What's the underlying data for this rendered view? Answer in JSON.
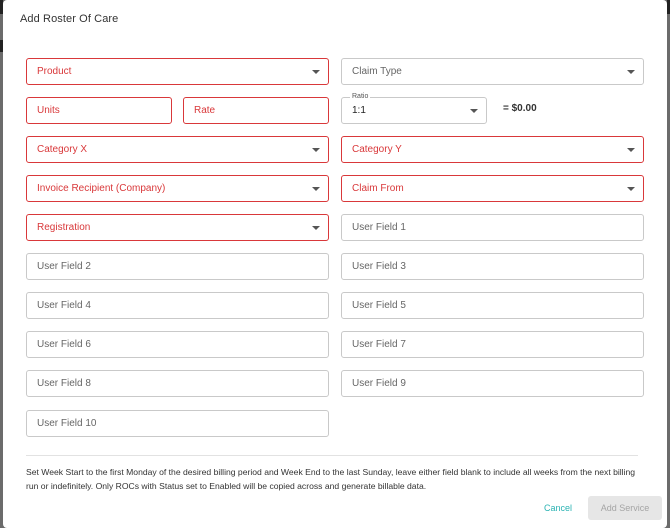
{
  "dialog": {
    "title": "Add Roster Of Care",
    "fields": {
      "product": "Product",
      "claim_type": "Claim Type",
      "units": "Units",
      "rate": "Rate",
      "ratio_label": "Ratio",
      "ratio_value": "1:1",
      "total": "= $0.00",
      "category_x": "Category X",
      "category_y": "Category Y",
      "invoice_recipient": "Invoice Recipient (Company)",
      "claim_from": "Claim From",
      "registration": "Registration",
      "user_field_1": "User Field 1",
      "user_field_2": "User Field 2",
      "user_field_3": "User Field 3",
      "user_field_4": "User Field 4",
      "user_field_5": "User Field 5",
      "user_field_6": "User Field 6",
      "user_field_7": "User Field 7",
      "user_field_8": "User Field 8",
      "user_field_9": "User Field 9",
      "user_field_10": "User Field 10"
    },
    "note": "Set Week Start to the first Monday of the desired billing period and Week End to the last Sunday, leave either field blank to include all weeks from the next billing run or indefinitely. Only ROCs with Status set to Enabled will be copied across and generate billable data.",
    "actions": {
      "cancel": "Cancel",
      "add_service": "Add Service"
    }
  },
  "colors": {
    "required_border": "#d9383a",
    "accent": "#2bb3b3",
    "disabled_button": "#e6e6e6"
  }
}
